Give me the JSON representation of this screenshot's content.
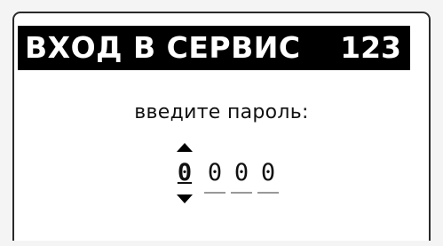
{
  "header": {
    "title": "ВХОД В СЕРВИС",
    "code": "123"
  },
  "prompt": "введите пароль:",
  "password": {
    "digits": [
      "0",
      "0",
      "0",
      "0"
    ],
    "active_index": 0
  },
  "icons": {
    "increment": "triangle-up-icon",
    "decrement": "triangle-down-icon"
  },
  "colors": {
    "background": "#ffffff",
    "title_bar": "#000000",
    "title_text": "#ffffff"
  }
}
